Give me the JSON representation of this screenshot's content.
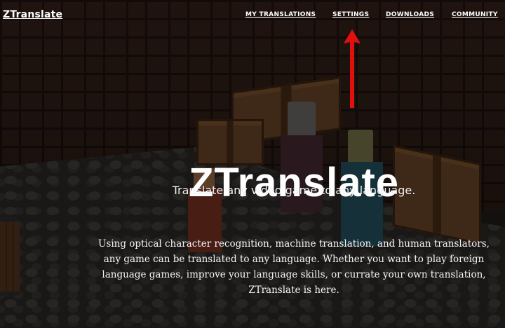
{
  "brand": {
    "name": "ZTranslate"
  },
  "nav": {
    "links": [
      {
        "label": "MY TRANSLATIONS"
      },
      {
        "label": "SETTINGS"
      },
      {
        "label": "DOWNLOADS"
      },
      {
        "label": "COMMUNITY"
      }
    ]
  },
  "hero": {
    "title": "ZTranslate",
    "subtitle": "Translate any video game to any language.",
    "description": "Using optical character recognition, machine translation, and human translators, any game can be translated to any language. Whether you want to play foreign language games, improve your language skills, or currate your own translation, ZTranslate is here."
  },
  "colors": {
    "annotation_arrow": "#e0100f",
    "text": "#ffffff"
  }
}
